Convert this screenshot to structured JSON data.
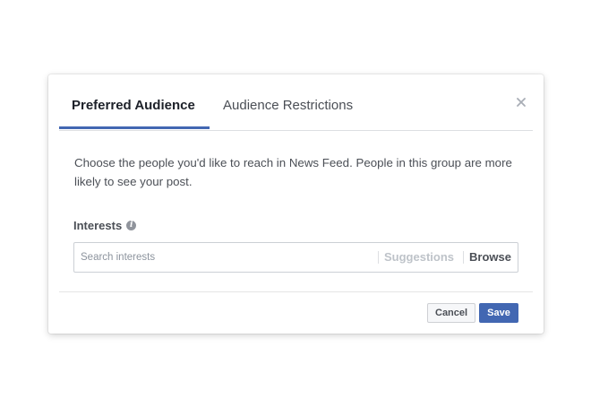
{
  "dialog": {
    "tabs": [
      {
        "label": "Preferred Audience",
        "active": true
      },
      {
        "label": "Audience Restrictions",
        "active": false
      }
    ],
    "close_icon": "close-icon",
    "description": "Choose the people you'd like to reach in News Feed. People in this group are more likely to see your post.",
    "interests": {
      "label": "Interests",
      "info_icon": "info-icon",
      "info_glyph": "i",
      "search_placeholder": "Search interests",
      "suggestions_label": "Suggestions",
      "browse_label": "Browse"
    },
    "footer": {
      "cancel_label": "Cancel",
      "save_label": "Save"
    }
  },
  "colors": {
    "accent": "#4267b2",
    "text_primary": "#1d2129",
    "text_secondary": "#4b4f56",
    "muted": "#bec3c9",
    "border": "#ccd0d5"
  }
}
